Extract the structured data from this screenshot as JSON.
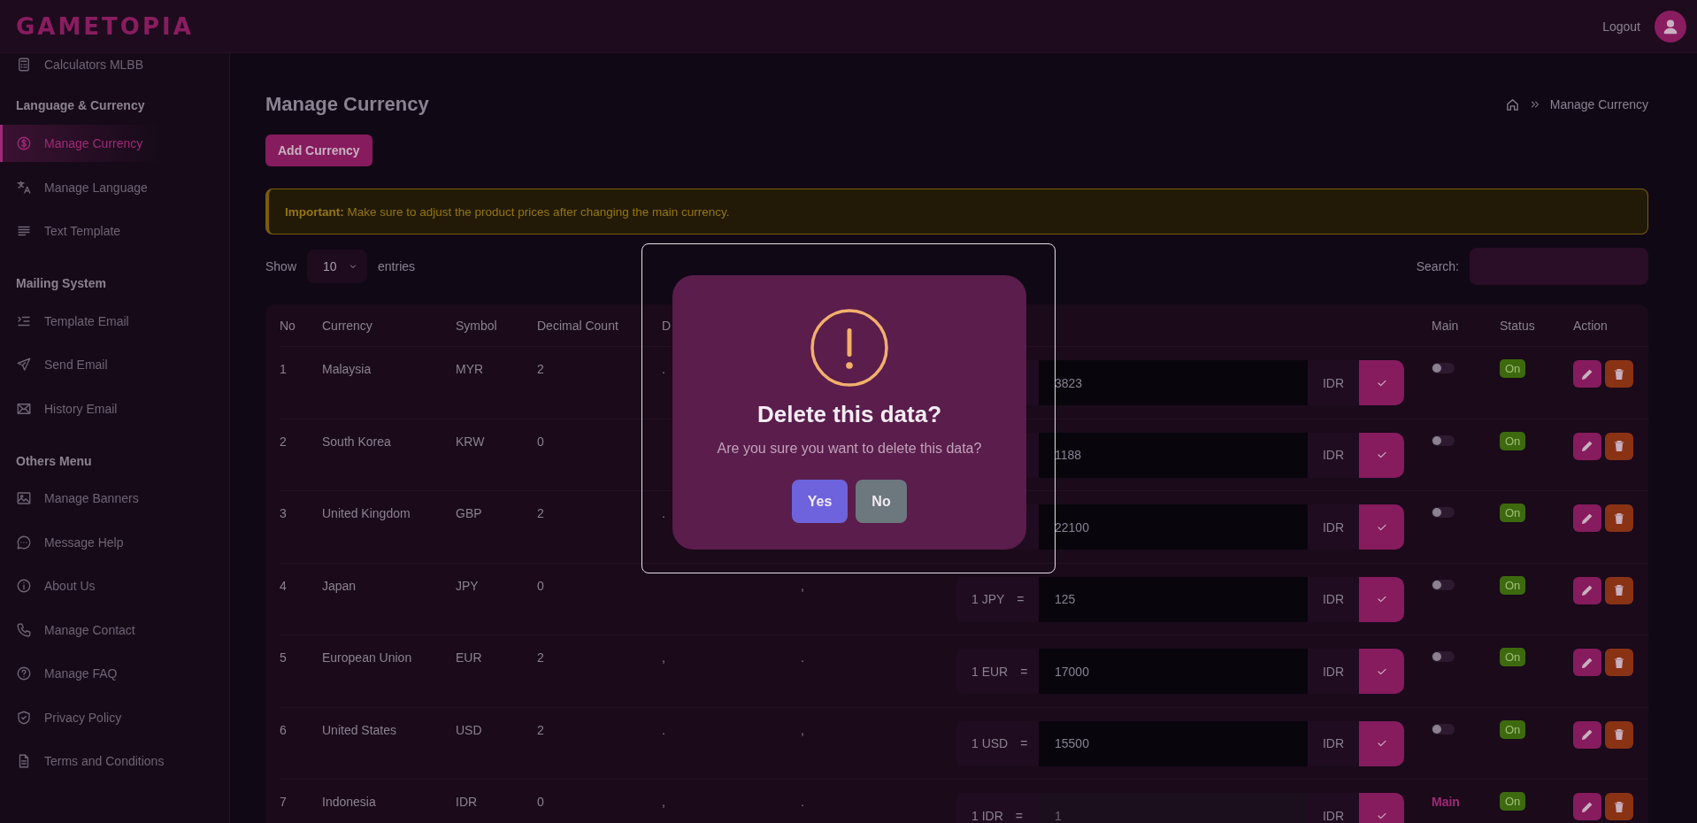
{
  "logo": "GAMETOPIA",
  "header": {
    "logout": "Logout"
  },
  "sidebar": {
    "sections": [
      {
        "items": [
          {
            "label": "Calculators MLBB",
            "selected": false
          }
        ]
      },
      {
        "heading": "Language & Currency",
        "items": [
          {
            "label": "Manage Currency",
            "selected": true
          },
          {
            "label": "Manage Language",
            "selected": false
          },
          {
            "label": "Text Template",
            "selected": false
          }
        ]
      },
      {
        "heading": "Mailing System",
        "items": [
          {
            "label": "Template Email",
            "selected": false
          },
          {
            "label": "Send Email",
            "selected": false
          },
          {
            "label": "History Email",
            "selected": false
          }
        ]
      },
      {
        "heading": "Others Menu",
        "items": [
          {
            "label": "Manage Banners",
            "selected": false
          },
          {
            "label": "Message Help",
            "selected": false
          },
          {
            "label": "About Us",
            "selected": false
          },
          {
            "label": "Manage Contact",
            "selected": false
          },
          {
            "label": "Manage FAQ",
            "selected": false
          },
          {
            "label": "Privacy Policy",
            "selected": false
          },
          {
            "label": "Terms and Conditions",
            "selected": false
          }
        ]
      }
    ]
  },
  "page": {
    "title": "Manage Currency",
    "breadcrumb": "Manage Currency",
    "add_button": "Add Currency",
    "alert": "**Important:** Make sure to adjust the product prices after changing the main currency.",
    "show_label": "Show",
    "entries_value": "10",
    "entries_label": "entries",
    "search_label": "Search:"
  },
  "table": {
    "columns": [
      "No",
      "Currency",
      "Symbol",
      "Decimal Count",
      "D",
      "",
      "",
      "Main",
      "Status",
      "Action"
    ],
    "rows": [
      {
        "no": "1",
        "currency": "Malaysia",
        "symbol": "MYR",
        "decimal_count": "2",
        "decimal_separator": ".",
        "rate": {
          "value": "3823",
          "unit": "IDR",
          "disabled": false
        },
        "main": {
          "kind": "toggle",
          "on": false
        },
        "status": "On"
      },
      {
        "no": "2",
        "currency": "South Korea",
        "symbol": "KRW",
        "decimal_count": "0",
        "rate": {
          "value": "1188",
          "unit": "IDR",
          "disabled": false
        },
        "main": {
          "kind": "toggle",
          "on": false
        },
        "status": "On"
      },
      {
        "no": "3",
        "currency": "United Kingdom",
        "symbol": "GBP",
        "decimal_count": "2",
        "decimal_separator": ".",
        "rate": {
          "value": "22100",
          "unit": "IDR",
          "disabled": false
        },
        "main": {
          "kind": "toggle",
          "on": false
        },
        "status": "On"
      },
      {
        "no": "4",
        "currency": "Japan",
        "symbol": "JPY",
        "decimal_count": "0",
        "thousand_separator": ",",
        "rate": {
          "prefix": "1 JPY",
          "equals": "=",
          "value": "125",
          "unit": "IDR",
          "disabled": false
        },
        "main": {
          "kind": "toggle",
          "on": false
        },
        "status": "On"
      },
      {
        "no": "5",
        "currency": "European Union",
        "symbol": "EUR",
        "decimal_count": "2",
        "decimal_separator": ",",
        "thousand_separator": ".",
        "rate": {
          "prefix": "1 EUR",
          "equals": "=",
          "value": "17000",
          "unit": "IDR",
          "disabled": false
        },
        "main": {
          "kind": "toggle",
          "on": false
        },
        "status": "On"
      },
      {
        "no": "6",
        "currency": "United States",
        "symbol": "USD",
        "decimal_count": "2",
        "decimal_separator": ".",
        "thousand_separator": ",",
        "rate": {
          "prefix": "1 USD",
          "equals": "=",
          "value": "15500",
          "unit": "IDR",
          "disabled": false
        },
        "main": {
          "kind": "toggle",
          "on": false
        },
        "status": "On"
      },
      {
        "no": "7",
        "currency": "Indonesia",
        "symbol": "IDR",
        "decimal_count": "0",
        "decimal_separator": ",",
        "thousand_separator": ".",
        "rate": {
          "prefix": "1 IDR",
          "equals": "=",
          "value": "1",
          "unit": "IDR",
          "disabled": true
        },
        "main": {
          "kind": "text",
          "text": "Main"
        },
        "status": "On"
      }
    ]
  },
  "dialog": {
    "title": "Delete this data?",
    "message": "Are you sure you want to delete this data?",
    "confirm": "Yes",
    "cancel": "No"
  }
}
